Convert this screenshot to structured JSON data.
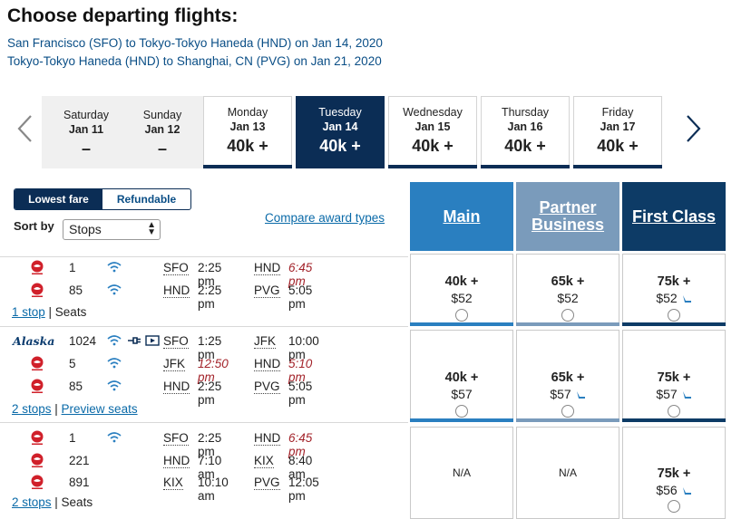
{
  "title": "Choose departing flights:",
  "routes": [
    "San Francisco (SFO) to Tokyo-Tokyo Haneda (HND) on Jan 14, 2020",
    "Tokyo-Tokyo Haneda (HND) to Shanghai, CN (PVG) on Jan 21, 2020"
  ],
  "dates": [
    {
      "day": "Saturday",
      "date": "Jan 11",
      "price": "–"
    },
    {
      "day": "Sunday",
      "date": "Jan 12",
      "price": "–"
    },
    {
      "day": "Monday",
      "date": "Jan 13",
      "price": "40k +"
    },
    {
      "day": "Tuesday",
      "date": "Jan 14",
      "price": "40k +"
    },
    {
      "day": "Wednesday",
      "date": "Jan 15",
      "price": "40k +"
    },
    {
      "day": "Thursday",
      "date": "Jan 16",
      "price": "40k +"
    },
    {
      "day": "Friday",
      "date": "Jan 17",
      "price": "40k +"
    }
  ],
  "fare_toggle": {
    "lowest": "Lowest fare",
    "refundable": "Refundable"
  },
  "sort": {
    "label": "Sort by",
    "value": "Stops"
  },
  "compare_link": "Compare award types",
  "cabins": {
    "main": "Main",
    "partner": "Partner Business",
    "first": "First Class"
  },
  "colors": {
    "main": "#2a7fc0",
    "partner": "#7a9bbb",
    "first": "#0d3b66",
    "selected_day": "#0b2d55"
  },
  "flights": [
    {
      "segments": [
        {
          "airline": "jal-logo",
          "flight": "1",
          "from": "SFO",
          "dep": "2:25 pm",
          "to": "HND",
          "arr": "6:45 pm",
          "arr_red": true
        },
        {
          "airline": "jal-logo",
          "flight": "85",
          "from": "HND",
          "dep": "2:25 pm",
          "to": "PVG",
          "arr": "5:05 pm"
        }
      ],
      "stops": "1 stop",
      "seats": "Seats",
      "fares": {
        "main": {
          "points": "40k +",
          "tax": "$52"
        },
        "partner": {
          "points": "65k +",
          "tax": "$52"
        },
        "first": {
          "points": "75k +",
          "tax": "$52"
        }
      }
    },
    {
      "segments": [
        {
          "airline": "Alaska",
          "flight": "1024",
          "from": "SFO",
          "dep": "1:25 pm",
          "to": "JFK",
          "arr": "10:00 pm"
        },
        {
          "airline": "jal-logo",
          "flight": "5",
          "from": "JFK",
          "dep": "12:50 pm",
          "dep_red": true,
          "to": "HND",
          "arr": "5:10 pm",
          "arr_red": true
        },
        {
          "airline": "jal-logo",
          "flight": "85",
          "from": "HND",
          "dep": "2:25 pm",
          "to": "PVG",
          "arr": "5:05 pm"
        }
      ],
      "stops": "2 stops",
      "seats": "Preview seats",
      "fares": {
        "main": {
          "points": "40k +",
          "tax": "$57"
        },
        "partner": {
          "points": "65k +",
          "tax": "$57"
        },
        "first": {
          "points": "75k +",
          "tax": "$57"
        }
      }
    },
    {
      "segments": [
        {
          "airline": "jal-logo",
          "flight": "1",
          "from": "SFO",
          "dep": "2:25 pm",
          "to": "HND",
          "arr": "6:45 pm",
          "arr_red": true
        },
        {
          "airline": "jal-logo",
          "flight": "221",
          "from": "HND",
          "dep": "7:10 am",
          "to": "KIX",
          "arr": "8:40 am"
        },
        {
          "airline": "jal-logo",
          "flight": "891",
          "from": "KIX",
          "dep": "10:10 am",
          "to": "PVG",
          "arr": "12:05 pm"
        }
      ],
      "stops": "2 stops",
      "seats": "Seats",
      "fares": {
        "main": {
          "na": "N/A"
        },
        "partner": {
          "na": "N/A"
        },
        "first": {
          "points": "75k +",
          "tax": "$56"
        }
      }
    }
  ]
}
